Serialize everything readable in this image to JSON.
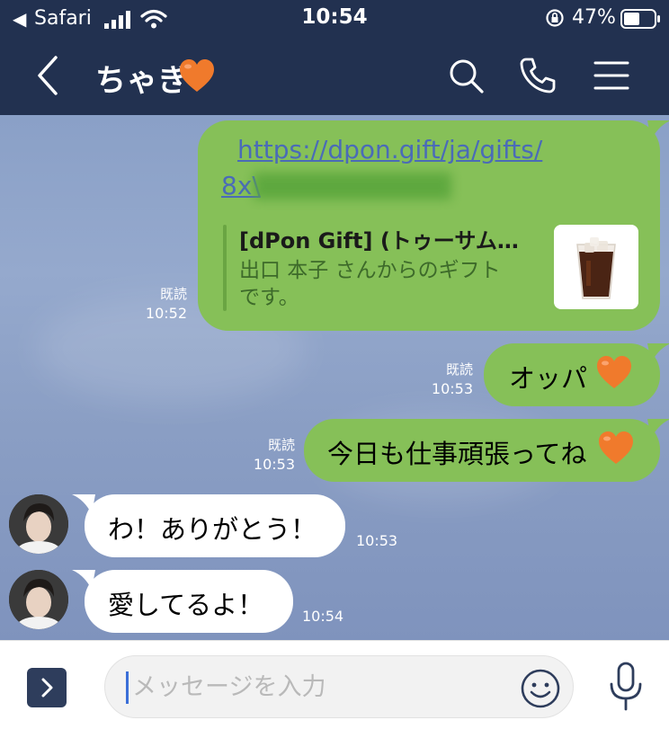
{
  "status_bar": {
    "back_app": "Safari",
    "time": "10:54",
    "battery_percent": "47%"
  },
  "header": {
    "title": "ちゃぎ",
    "back_icon": "chevron-left-icon",
    "actions": [
      "search-icon",
      "phone-icon",
      "menu-icon"
    ]
  },
  "messages": [
    {
      "direction": "out",
      "type": "link",
      "link_line1": "https://dpon.gift/ja/gifts/",
      "link_line2": "8x\\",
      "preview_title": "[dPon Gift] (トゥーサム…",
      "preview_desc": "出口 本子 さんからのギフトです。",
      "read": "既読",
      "time": "10:52"
    },
    {
      "direction": "out",
      "type": "text",
      "text": "オッパ",
      "read": "既読",
      "time": "10:53"
    },
    {
      "direction": "out",
      "type": "text",
      "text": "今日も仕事頑張ってね",
      "read": "既読",
      "time": "10:53"
    },
    {
      "direction": "in",
      "type": "text",
      "text": "わ！ありがとう！",
      "time": "10:53"
    },
    {
      "direction": "in",
      "type": "text",
      "text": "愛してるよ！",
      "time": "10:54"
    }
  ],
  "input": {
    "placeholder": "メッセージを入力"
  },
  "colors": {
    "header_bg": "#223150",
    "chat_bg": "#8aa0c7",
    "outgoing_bubble": "#86c058",
    "incoming_bubble": "#ffffff",
    "heart": "#f07a2c",
    "link": "#4a6bb8"
  }
}
